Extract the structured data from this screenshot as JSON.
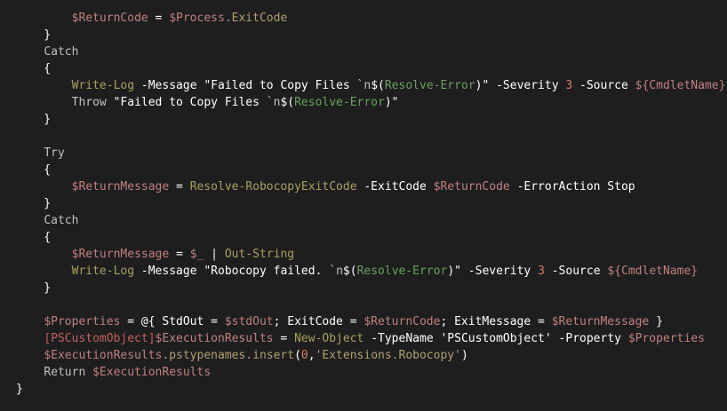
{
  "editor": {
    "lines": [
      [
        {
          "t": "        "
        },
        {
          "t": "$ReturnCode",
          "c": "var"
        },
        {
          "t": " = ",
          "c": "pun"
        },
        {
          "t": "$Process",
          "c": "var"
        },
        {
          "t": ".ExitCode",
          "c": "prop"
        }
      ],
      [
        {
          "t": "    }",
          "c": "pun"
        }
      ],
      [
        {
          "t": "    "
        },
        {
          "t": "Catch",
          "c": "kw"
        }
      ],
      [
        {
          "t": "    {",
          "c": "pun"
        }
      ],
      [
        {
          "t": "        "
        },
        {
          "t": "Write-Log",
          "c": "cmd"
        },
        {
          "t": " "
        },
        {
          "t": "-Message",
          "c": "par"
        },
        {
          "t": " \"Failed to Copy Files ",
          "c": "str"
        },
        {
          "t": "`n",
          "c": "esc"
        },
        {
          "t": "$(",
          "c": "str"
        },
        {
          "t": "Resolve-Error",
          "c": "grn"
        },
        {
          "t": ")\" ",
          "c": "str"
        },
        {
          "t": "-Severity",
          "c": "par"
        },
        {
          "t": " "
        },
        {
          "t": "3",
          "c": "num"
        },
        {
          "t": " "
        },
        {
          "t": "-Source",
          "c": "par"
        },
        {
          "t": " "
        },
        {
          "t": "${CmdletName}",
          "c": "var"
        }
      ],
      [
        {
          "t": "        "
        },
        {
          "t": "Throw",
          "c": "kw"
        },
        {
          "t": " \"Failed to Copy Files ",
          "c": "str"
        },
        {
          "t": "`n",
          "c": "esc"
        },
        {
          "t": "$(",
          "c": "str"
        },
        {
          "t": "Resolve-Error",
          "c": "grn"
        },
        {
          "t": ")\"",
          "c": "str"
        }
      ],
      [
        {
          "t": "    }",
          "c": "pun"
        }
      ],
      [
        {
          "t": ""
        }
      ],
      [
        {
          "t": "    "
        },
        {
          "t": "Try",
          "c": "kw"
        }
      ],
      [
        {
          "t": "    {",
          "c": "pun"
        }
      ],
      [
        {
          "t": "        "
        },
        {
          "t": "$ReturnMessage",
          "c": "var"
        },
        {
          "t": " = ",
          "c": "pun"
        },
        {
          "t": "Resolve-RobocopyExitCode",
          "c": "cmd"
        },
        {
          "t": " "
        },
        {
          "t": "-ExitCode",
          "c": "par"
        },
        {
          "t": " "
        },
        {
          "t": "$ReturnCode",
          "c": "var"
        },
        {
          "t": " "
        },
        {
          "t": "-ErrorAction",
          "c": "par"
        },
        {
          "t": " Stop",
          "c": "par"
        }
      ],
      [
        {
          "t": "    }",
          "c": "pun"
        }
      ],
      [
        {
          "t": "    "
        },
        {
          "t": "Catch",
          "c": "kw"
        }
      ],
      [
        {
          "t": "    {",
          "c": "pun"
        }
      ],
      [
        {
          "t": "        "
        },
        {
          "t": "$ReturnMessage",
          "c": "var"
        },
        {
          "t": " = ",
          "c": "pun"
        },
        {
          "t": "$_",
          "c": "var"
        },
        {
          "t": " | ",
          "c": "pun"
        },
        {
          "t": "Out-String",
          "c": "cmd"
        }
      ],
      [
        {
          "t": "        "
        },
        {
          "t": "Write-Log",
          "c": "cmd"
        },
        {
          "t": " "
        },
        {
          "t": "-Message",
          "c": "par"
        },
        {
          "t": " \"Robocopy failed. ",
          "c": "str"
        },
        {
          "t": "`n",
          "c": "esc"
        },
        {
          "t": "$(",
          "c": "str"
        },
        {
          "t": "Resolve-Error",
          "c": "grn"
        },
        {
          "t": ")\" ",
          "c": "str"
        },
        {
          "t": "-Severity",
          "c": "par"
        },
        {
          "t": " "
        },
        {
          "t": "3",
          "c": "num"
        },
        {
          "t": " "
        },
        {
          "t": "-Source",
          "c": "par"
        },
        {
          "t": " "
        },
        {
          "t": "${CmdletName}",
          "c": "var"
        }
      ],
      [
        {
          "t": "    }",
          "c": "pun"
        }
      ],
      [
        {
          "t": ""
        }
      ],
      [
        {
          "t": "    "
        },
        {
          "t": "$Properties",
          "c": "var"
        },
        {
          "t": " = ",
          "c": "pun"
        },
        {
          "t": "@{ StdOut = ",
          "c": "pun"
        },
        {
          "t": "$stdOut",
          "c": "var"
        },
        {
          "t": "; ExitCode = ",
          "c": "pun"
        },
        {
          "t": "$ReturnCode",
          "c": "var"
        },
        {
          "t": "; ExitMessage = ",
          "c": "pun"
        },
        {
          "t": "$ReturnMessage",
          "c": "var"
        },
        {
          "t": " }",
          "c": "pun"
        }
      ],
      [
        {
          "t": "    "
        },
        {
          "t": "[PSCustomObject]",
          "c": "type"
        },
        {
          "t": "$ExecutionResults",
          "c": "var"
        },
        {
          "t": " = ",
          "c": "pun"
        },
        {
          "t": "New-Object",
          "c": "cmd"
        },
        {
          "t": " "
        },
        {
          "t": "-TypeName",
          "c": "par"
        },
        {
          "t": " 'PSCustomObject' ",
          "c": "str"
        },
        {
          "t": "-Property",
          "c": "par"
        },
        {
          "t": " "
        },
        {
          "t": "$Properties",
          "c": "var"
        }
      ],
      [
        {
          "t": "    "
        },
        {
          "t": "$ExecutionResults",
          "c": "var"
        },
        {
          "t": ".pstypenames.insert",
          "c": "prop"
        },
        {
          "t": "(",
          "c": "pun"
        },
        {
          "t": "0",
          "c": "num"
        },
        {
          "t": ",",
          "c": "pun"
        },
        {
          "t": "'Extensions.Robocopy'",
          "c": "prop"
        },
        {
          "t": ")",
          "c": "pun"
        }
      ],
      [
        {
          "t": "    "
        },
        {
          "t": "Return",
          "c": "kw"
        },
        {
          "t": " "
        },
        {
          "t": "$ExecutionResults",
          "c": "var"
        }
      ],
      [
        {
          "t": "}",
          "c": "pun"
        }
      ]
    ]
  }
}
